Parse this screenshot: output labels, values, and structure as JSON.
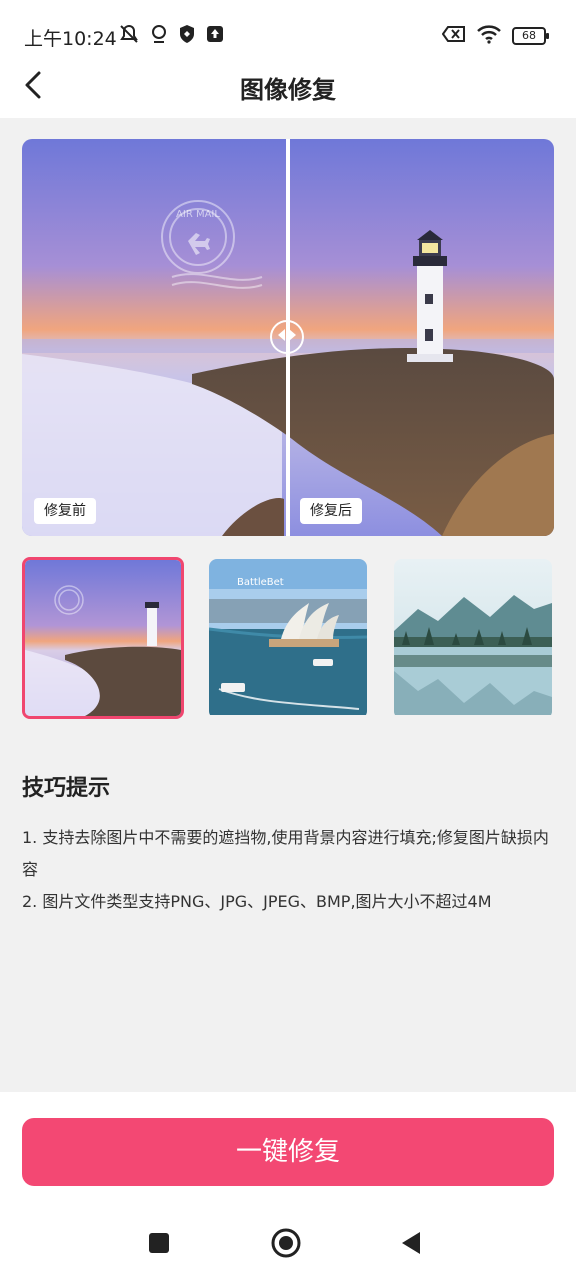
{
  "status_bar": {
    "time": "上午10:24",
    "battery_level": "68",
    "icons_left": [
      "notification-muted-icon",
      "location-icon",
      "shield-icon",
      "upload-icon"
    ],
    "icons_right": [
      "sim-off-icon",
      "wifi-icon",
      "battery-icon"
    ]
  },
  "header": {
    "title": "图像修复",
    "back_icon": "chevron-left-icon"
  },
  "compare": {
    "before_label": "修复前",
    "after_label": "修复后",
    "watermark_text": "AIR MAIL"
  },
  "samples": [
    {
      "name": "lighthouse-sample",
      "selected": true
    },
    {
      "name": "opera-house-sample",
      "selected": false,
      "watermark": "BattleBet"
    },
    {
      "name": "lake-mountain-sample",
      "selected": false
    }
  ],
  "tips": {
    "title": "技巧提示",
    "items": [
      "1. 支持去除图片中不需要的遮挡物,使用背景内容进行填充;修复图片缺损内容",
      "2. 图片文件类型支持PNG、JPG、JPEG、BMP,图片大小不超过4M"
    ]
  },
  "action": {
    "repair_label": "一键修复"
  },
  "colors": {
    "accent": "#f34873",
    "selected_border": "#f0466f",
    "background": "#f1f1f1"
  },
  "nav_bar": {
    "icons": [
      "recent-apps-icon",
      "home-icon",
      "back-icon"
    ]
  }
}
